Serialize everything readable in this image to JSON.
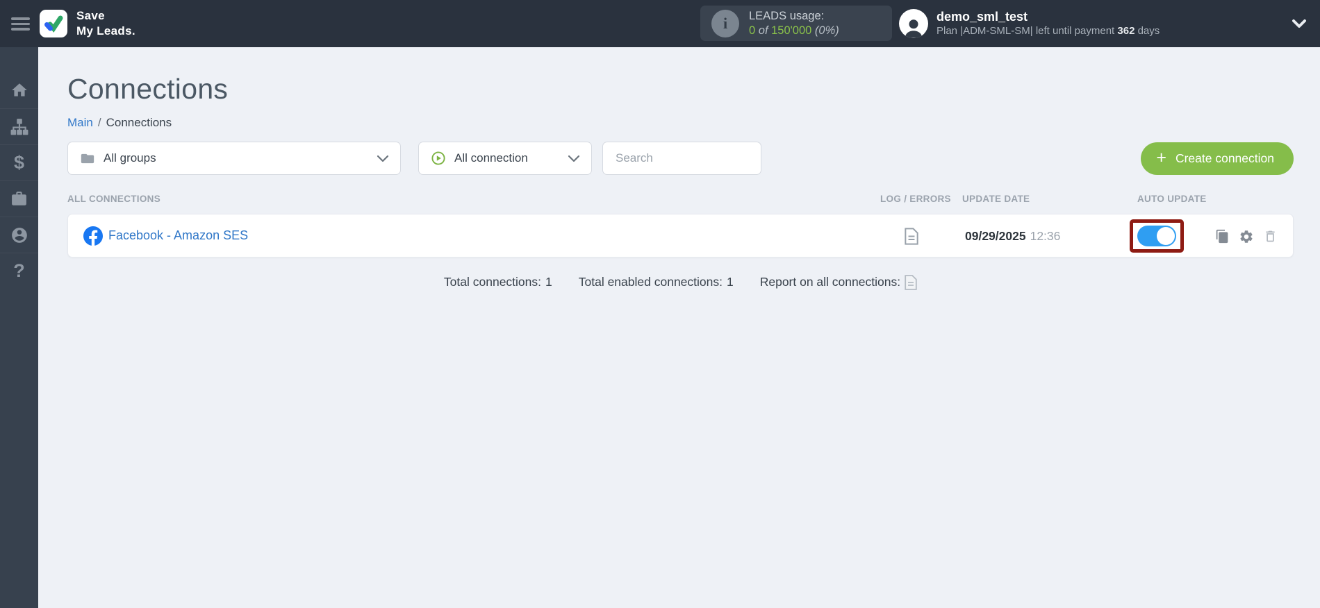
{
  "header": {
    "logo_line1": "Save",
    "logo_line2": "My Leads.",
    "leads_usage": {
      "label": "LEADS usage:",
      "used": "0",
      "of_word": " of ",
      "total": "150'000",
      "percent": " (0%)"
    },
    "user": {
      "name": "demo_sml_test",
      "plan_before": "Plan |ADM-SML-SM| left until payment ",
      "days": "362",
      "plan_after": " days"
    }
  },
  "sidebar": {
    "icons": [
      "home-icon",
      "sitemap-icon",
      "dollar-icon",
      "briefcase-icon",
      "user-icon",
      "help-icon"
    ],
    "dollar_glyph": "$",
    "help_glyph": "?"
  },
  "page": {
    "title": "Connections",
    "breadcrumb": {
      "root": "Main",
      "separator": "/",
      "current": "Connections"
    }
  },
  "filters": {
    "groups_value": "All groups",
    "connections_value": "All connection",
    "search_placeholder": "Search",
    "create_plus": "+",
    "create_label": "Create connection"
  },
  "table": {
    "headers": {
      "connections": "ALL CONNECTIONS",
      "log": "LOG / ERRORS",
      "update": "UPDATE DATE",
      "auto": "AUTO UPDATE"
    },
    "rows": [
      {
        "title": "Facebook - Amazon SES",
        "date": "09/29/2025",
        "time": "12:36",
        "auto_update": "on"
      }
    ]
  },
  "summary": {
    "total_label": "Total connections:",
    "total_value": "1",
    "enabled_label": "Total enabled connections:",
    "enabled_value": "1",
    "report_label": "Report on all connections:"
  },
  "colors": {
    "header_bg": "#2a323e",
    "sidebar_bg": "#37414e",
    "main_bg": "#eef1f6",
    "accent_green_button": "#85bd4a",
    "usage_green": "#8bc34a",
    "link_blue": "#3077c8",
    "toggle_blue": "#2f9ef2",
    "highlight_red": "#8e1b13",
    "facebook_blue": "#1877f2"
  }
}
